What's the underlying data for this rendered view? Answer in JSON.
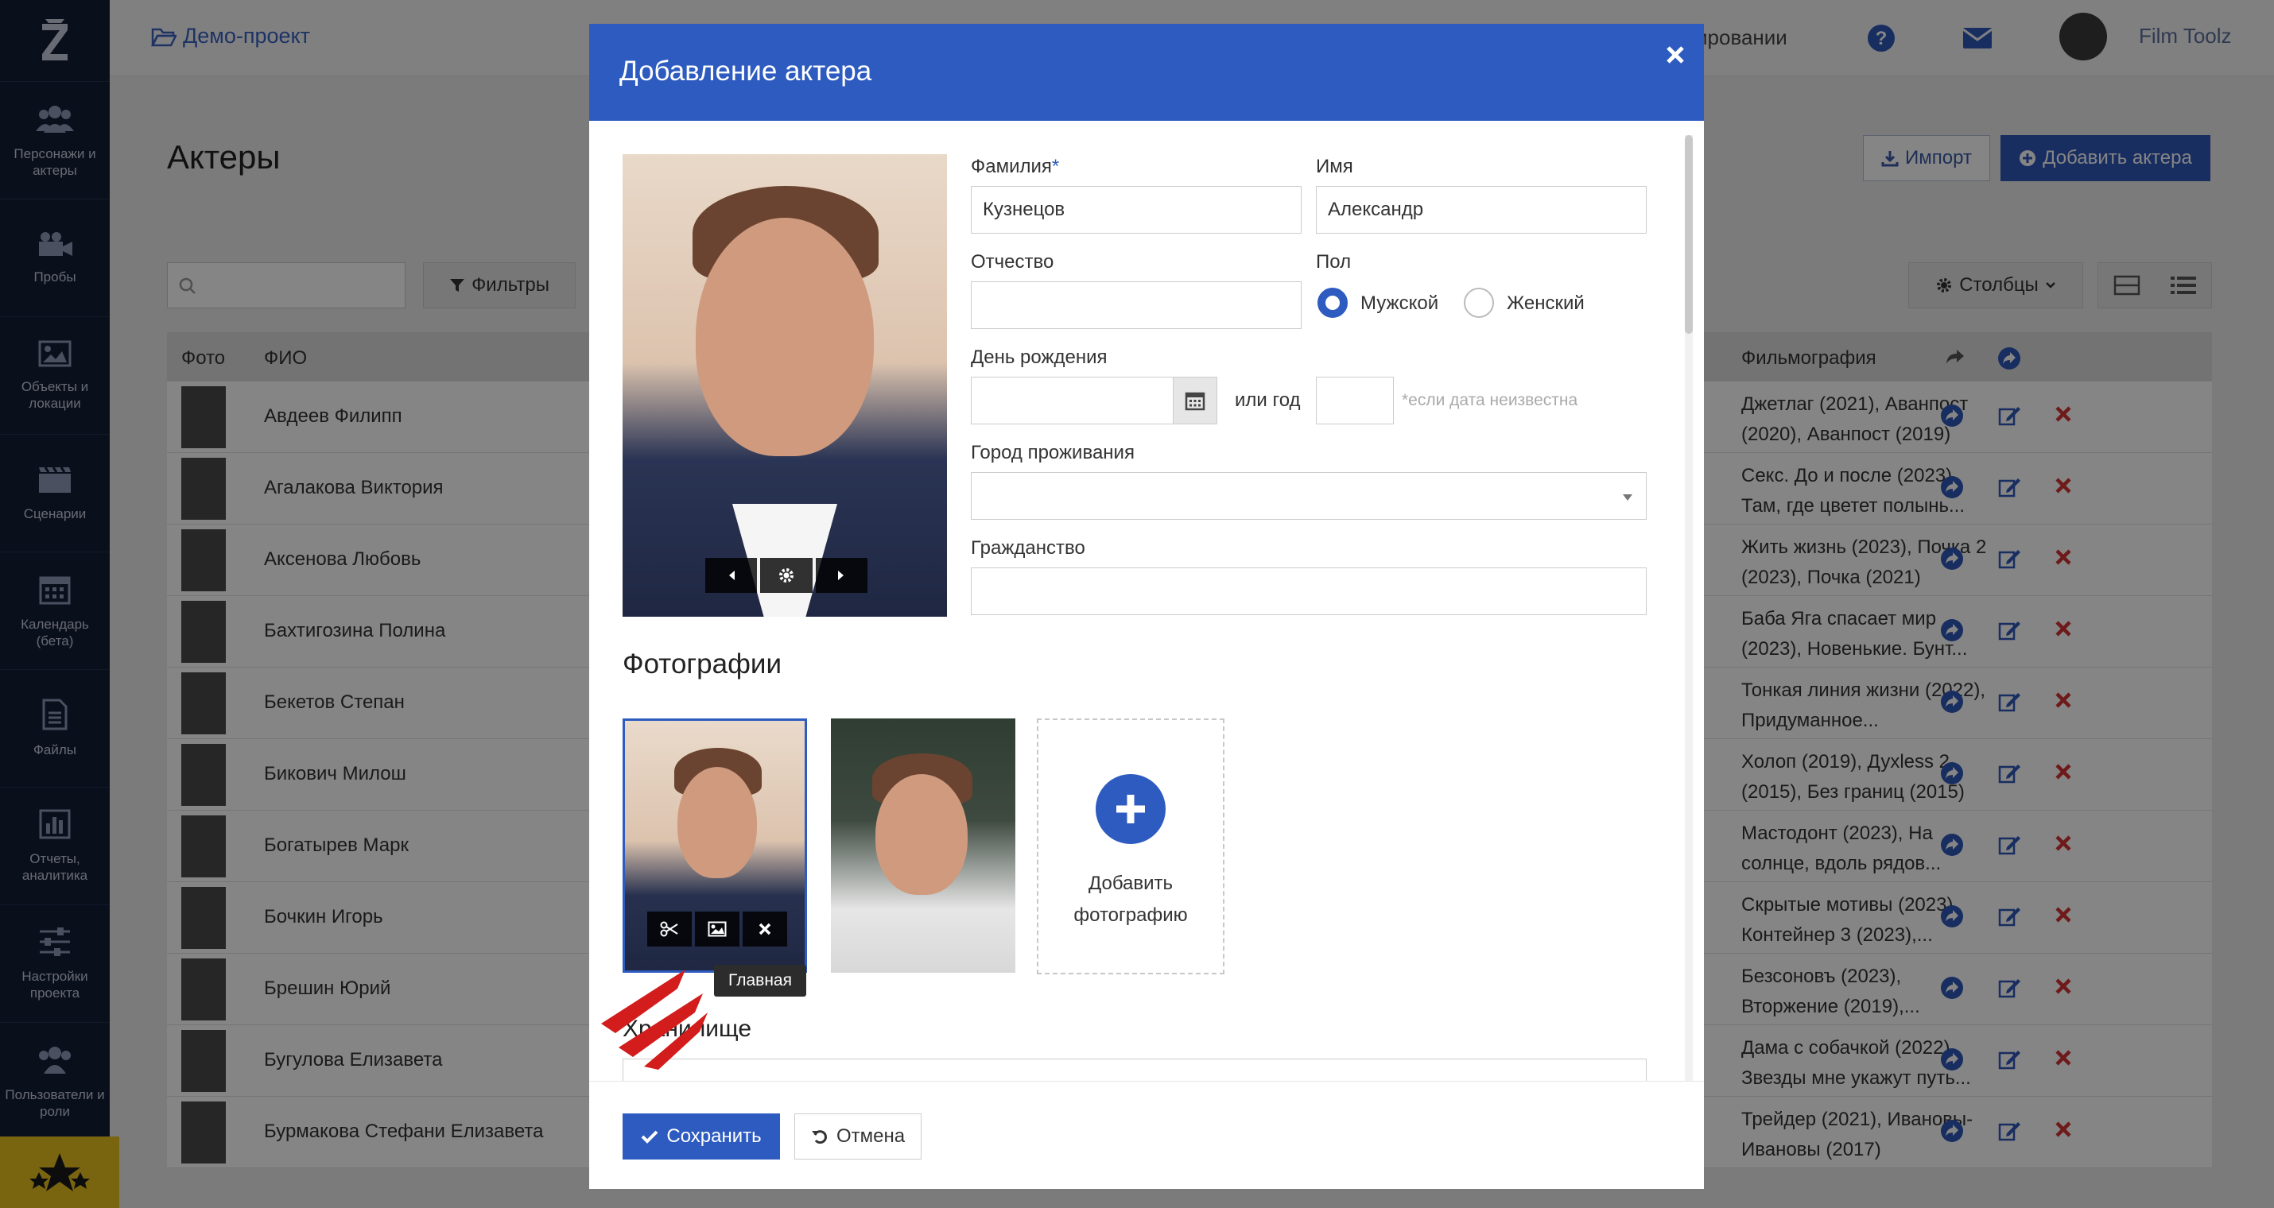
{
  "sidebar": {
    "logo_letter": "Z",
    "items": [
      {
        "label": "Персонажи и актеры"
      },
      {
        "label": "Пробы"
      },
      {
        "label": "Объекты и локации"
      },
      {
        "label": "Сценарии"
      },
      {
        "label": "Календарь (бета)"
      },
      {
        "label": "Файлы"
      },
      {
        "label": "Отчеты, аналитика"
      },
      {
        "label": "Настройки проекта"
      },
      {
        "label": "Пользователи и роли"
      }
    ]
  },
  "topbar": {
    "project": "Демо-проект",
    "partial_text": "ировании",
    "user": "Film Toolz"
  },
  "page": {
    "title": "Актеры",
    "import_label": "Импорт",
    "add_actor_label": "Добавить актера",
    "filters_label": "Фильтры",
    "columns_label": "Столбцы"
  },
  "table": {
    "headers": {
      "photo": "Фото",
      "name": "ФИО",
      "films": "Фильмография"
    },
    "rows": [
      {
        "name": "Авдеев Филипп",
        "films": "Джетлаг (2021), Аванпост (2020), Аванпост (2019)"
      },
      {
        "name": "Агалакова Виктория",
        "films": "Секс. До и после (2023), Там, где цветет полынь..."
      },
      {
        "name": "Аксенова Любовь",
        "films": "Жить жизнь (2023), Почка 2 (2023), Почка (2021)"
      },
      {
        "name": "Бахтигозина Полина",
        "films": "Баба Яга спасает мир (2023), Новенькие. Бунт..."
      },
      {
        "name": "Бекетов Степан",
        "films": "Тонкая линия жизни (2022), Придуманное..."
      },
      {
        "name": "Бикович Милош",
        "films": "Холоп (2019), Дуxless 2 (2015), Без границ (2015)"
      },
      {
        "name": "Богатырев Марк",
        "films": "Мастодонт (2023), На солнце, вдоль рядов..."
      },
      {
        "name": "Бочкин Игорь",
        "films": "Скрытые мотивы (2023), Контейнер 3 (2023),..."
      },
      {
        "name": "Брешин Юрий",
        "films": "Безсоновъ (2023), Вторжение (2019),..."
      },
      {
        "name": "Бугулова Елизавета",
        "films": "Дама с собачкой (2022), Звезды мне укажут путь..."
      },
      {
        "name": "Бурмакова Стефани Елизавета",
        "films": "Трейдер (2021), Ивановы-Ивановы (2017)"
      }
    ]
  },
  "modal": {
    "title": "Добавление актера",
    "fields": {
      "last_name_label": "Фамилия",
      "last_name_required": "*",
      "last_name_value": "Кузнецов",
      "first_name_label": "Имя",
      "first_name_value": "Александр",
      "middle_name_label": "Отчество",
      "middle_name_value": "",
      "gender_label": "Пол",
      "gender_male": "Мужской",
      "gender_female": "Женский",
      "birthday_label": "День рождения",
      "or_year": "или год",
      "year_hint": "*если дата неизвестна",
      "city_label": "Город проживания",
      "citizenship_label": "Гражданство"
    },
    "photos_title": "Фотографии",
    "add_photo_label": "Добавить фотографию",
    "tooltip": "Главная",
    "storage_title": "Хранилище",
    "save_label": "Сохранить",
    "cancel_label": "Отмена"
  },
  "colors": {
    "accent": "#2e5bbf",
    "sidebar_bg": "#141d36",
    "danger": "#d33333"
  }
}
